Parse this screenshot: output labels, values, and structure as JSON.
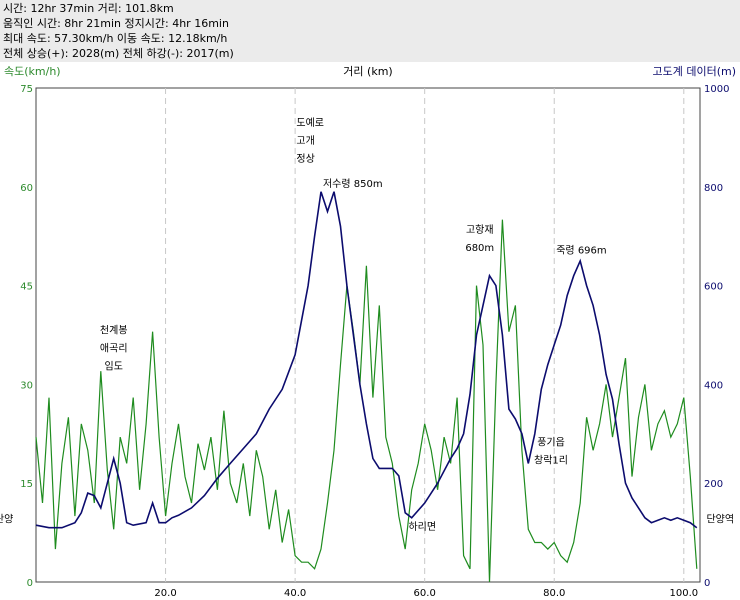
{
  "stats": {
    "lines": [
      "시간: 12hr 37min   거리: 101.8km",
      "움직인 시간: 8hr 21min   정지시간: 4hr 16min",
      "최대 속도: 57.30km/h   이동 속도: 12.18km/h",
      "전체 상승(+): 2028(m)   전체 하강(-): 2017(m)"
    ]
  },
  "chart_data": {
    "type": "line",
    "left_axis_label": "속도(km/h)",
    "x_axis_label": "거리 (km)",
    "right_axis_label": "고도계 데이터(m)",
    "xlim": [
      0,
      102.5
    ],
    "ylim_left": [
      0,
      75
    ],
    "ylim_right": [
      0,
      1000
    ],
    "left_ticks": [
      0,
      15,
      30,
      45,
      60,
      75
    ],
    "right_ticks": [
      0,
      200,
      400,
      600,
      800,
      1000
    ],
    "x_ticks": [
      20.0,
      40.0,
      60.0,
      80.0,
      100.0
    ],
    "x_tick_labels": [
      "20.0",
      "40.0",
      "60.0",
      "80.0",
      "100.0"
    ],
    "vertical_gridlines_x": [
      20,
      40,
      60,
      80,
      100
    ],
    "colors": {
      "speed": "#1f8c1f",
      "elevation": "#0c0c6e",
      "left_axis": "#2e8b2e",
      "right_axis": "#0c0c6e",
      "grid": "#c8c8c8"
    },
    "series": [
      {
        "axis": "right",
        "x": [
          0,
          2,
          4,
          6,
          7,
          8,
          9,
          10,
          11,
          12,
          13,
          14,
          15,
          17,
          18,
          19,
          20,
          21,
          22,
          24,
          26,
          28,
          30,
          32,
          34,
          36,
          38,
          40,
          41,
          42,
          43,
          44,
          45,
          46,
          47,
          48,
          49,
          50,
          51,
          52,
          53,
          54,
          55,
          56,
          57,
          58,
          60,
          62,
          64,
          65,
          66,
          67,
          68,
          69,
          70,
          71,
          72,
          73,
          74,
          75,
          76,
          77,
          78,
          79,
          80,
          81,
          82,
          83,
          84,
          85,
          86,
          87,
          88,
          89,
          90,
          91,
          92,
          93,
          94,
          95,
          96,
          97,
          98,
          99,
          100,
          101,
          102
        ],
        "y": [
          115,
          110,
          110,
          120,
          140,
          180,
          175,
          150,
          200,
          250,
          200,
          120,
          115,
          120,
          160,
          120,
          120,
          130,
          135,
          150,
          175,
          210,
          240,
          270,
          300,
          350,
          390,
          460,
          530,
          600,
          700,
          790,
          750,
          790,
          720,
          600,
          500,
          400,
          320,
          250,
          230,
          230,
          230,
          215,
          140,
          130,
          160,
          200,
          250,
          270,
          300,
          380,
          500,
          560,
          620,
          600,
          500,
          350,
          330,
          300,
          240,
          300,
          390,
          440,
          480,
          520,
          580,
          620,
          650,
          600,
          560,
          500,
          420,
          370,
          280,
          200,
          170,
          150,
          130,
          120,
          125,
          130,
          125,
          130,
          125,
          120,
          110
        ]
      },
      {
        "axis": "left",
        "x": [
          0,
          1,
          2,
          3,
          4,
          5,
          6,
          7,
          8,
          9,
          10,
          11,
          12,
          13,
          14,
          15,
          16,
          17,
          18,
          19,
          20,
          21,
          22,
          23,
          24,
          25,
          26,
          27,
          28,
          29,
          30,
          31,
          32,
          33,
          34,
          35,
          36,
          37,
          38,
          39,
          40,
          41,
          42,
          43,
          44,
          45,
          46,
          47,
          48,
          49,
          50,
          51,
          52,
          53,
          54,
          55,
          56,
          57,
          58,
          59,
          60,
          61,
          62,
          63,
          64,
          65,
          66,
          67,
          68,
          69,
          70,
          71,
          72,
          73,
          74,
          75,
          76,
          77,
          78,
          79,
          80,
          81,
          82,
          83,
          84,
          85,
          86,
          87,
          88,
          89,
          90,
          91,
          92,
          93,
          94,
          95,
          96,
          97,
          98,
          99,
          100,
          101,
          102
        ],
        "y": [
          22,
          12,
          28,
          5,
          18,
          25,
          10,
          24,
          20,
          12,
          32,
          17,
          8,
          22,
          18,
          28,
          14,
          24,
          38,
          22,
          10,
          18,
          24,
          16,
          12,
          21,
          17,
          22,
          14,
          26,
          15,
          12,
          18,
          10,
          20,
          16,
          8,
          14,
          6,
          11,
          4,
          3,
          3,
          2,
          5,
          12,
          20,
          33,
          45,
          38,
          30,
          48,
          28,
          42,
          22,
          18,
          10,
          5,
          14,
          18,
          24,
          20,
          14,
          22,
          18,
          28,
          4,
          2,
          45,
          36,
          0,
          30,
          55,
          38,
          42,
          20,
          8,
          6,
          6,
          5,
          6,
          4,
          3,
          6,
          12,
          25,
          20,
          24,
          30,
          22,
          28,
          34,
          16,
          25,
          30,
          20,
          24,
          26,
          22,
          24,
          28,
          16,
          2
        ]
      }
    ],
    "annotations": [
      {
        "lines": [
          "천계봉",
          "애곡리",
          "임도"
        ],
        "x": 12,
        "elev": 430,
        "align": "middle"
      },
      {
        "lines": [
          "도예로",
          "고개",
          "정상"
        ],
        "x": 40.2,
        "elev": 850,
        "align": "start"
      },
      {
        "lines": [
          "저수령 850m"
        ],
        "x": 44.3,
        "elev": 800,
        "align": "start"
      },
      {
        "lines": [
          "하리면"
        ],
        "x": 57.5,
        "elev": 105,
        "align": "start"
      },
      {
        "lines": [
          "고항재",
          "680m"
        ],
        "x": 68.5,
        "elev": 670,
        "align": "middle"
      },
      {
        "lines": [
          "죽령 696m"
        ],
        "x": 84.2,
        "elev": 665,
        "align": "middle"
      },
      {
        "lines": [
          "풍기읍",
          "창락1리"
        ],
        "x": 79.5,
        "elev": 240,
        "align": "middle"
      },
      {
        "lines": [
          "단양"
        ],
        "x": -3.5,
        "elev": 120,
        "align": "end"
      },
      {
        "lines": [
          "단양역"
        ],
        "x": 103.5,
        "elev": 120,
        "align": "start"
      }
    ]
  }
}
